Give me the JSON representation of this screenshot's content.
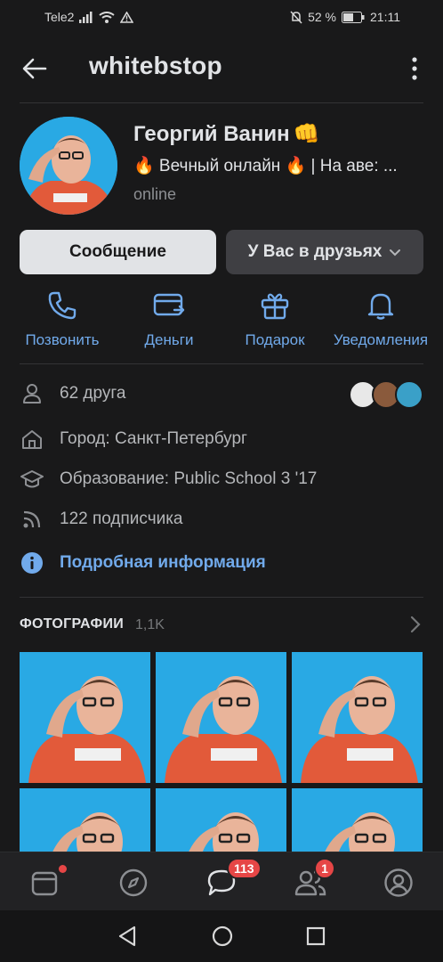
{
  "status_bar": {
    "carrier": "Tele2",
    "battery": "52 %",
    "time": "21:11"
  },
  "header": {
    "title": "whitebstop"
  },
  "profile": {
    "name": "Георгий Ванин",
    "name_emoji": "👊",
    "status": "🔥 Вечный онлайн 🔥 | На аве: ...",
    "online": "online"
  },
  "actions": {
    "message_label": "Сообщение",
    "friends_label": "У Вас в друзьях"
  },
  "quick_actions": [
    {
      "label": "Позвонить",
      "icon": "phone-icon"
    },
    {
      "label": "Деньги",
      "icon": "money-icon"
    },
    {
      "label": "Подарок",
      "icon": "gift-icon"
    },
    {
      "label": "Уведомления",
      "icon": "bell-icon"
    }
  ],
  "info": {
    "friends": "62 друга",
    "city": "Город: Санкт-Петербург",
    "education": "Образование: Public School 3 '17",
    "followers": "122 подписчика",
    "details": "Подробная информация"
  },
  "photos": {
    "title": "ФОТОГРАФИИ",
    "count": "1,1K"
  },
  "tabbar": {
    "messages_badge": "113",
    "friends_badge": "1"
  },
  "colors": {
    "background": "#19191a",
    "accent": "#71aaeb",
    "badge": "#e64646",
    "photo_bg": "#29a9e4"
  }
}
